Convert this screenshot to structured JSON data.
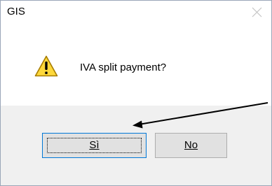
{
  "dialog": {
    "title": "GIS",
    "message": "IVA split payment?",
    "icons": {
      "close": "close-icon",
      "warning": "warning-icon"
    },
    "buttons": {
      "yes_label": "Sì",
      "no_label": "No"
    },
    "annotation": {
      "type": "arrow",
      "points_to": "yes-button",
      "color": "#000000"
    }
  }
}
